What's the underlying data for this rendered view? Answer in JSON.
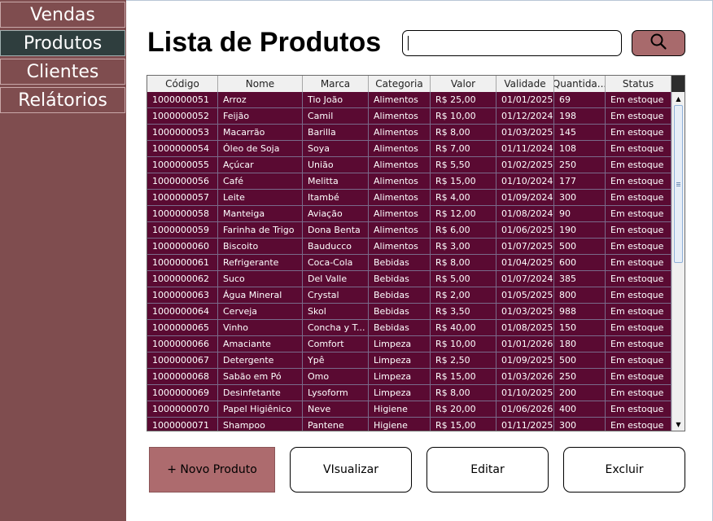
{
  "sidebar": {
    "items": [
      {
        "label": "Vendas"
      },
      {
        "label": "Produtos"
      },
      {
        "label": "Clientes"
      },
      {
        "label": "Relátorios"
      }
    ],
    "active": "Produtos"
  },
  "header": {
    "title": "Lista de Produtos"
  },
  "search": {
    "value": "",
    "placeholder": "",
    "button_icon": "search-icon"
  },
  "table": {
    "columns": [
      "Código",
      "Nome",
      "Marca",
      "Categoria",
      "Valor",
      "Validade",
      "Quantida...",
      "Status"
    ],
    "rows": [
      [
        "1000000051",
        "Arroz",
        "Tio João",
        "Alimentos",
        "R$ 25,00",
        "01/01/2025",
        "69",
        "Em estoque"
      ],
      [
        "1000000052",
        "Feijão",
        "Camil",
        "Alimentos",
        "R$ 10,00",
        "01/12/2024",
        "198",
        "Em estoque"
      ],
      [
        "1000000053",
        "Macarrão",
        "Barilla",
        "Alimentos",
        "R$ 8,00",
        "01/03/2025",
        "145",
        "Em estoque"
      ],
      [
        "1000000054",
        "Óleo de Soja",
        "Soya",
        "Alimentos",
        "R$ 7,00",
        "01/11/2024",
        "108",
        "Em estoque"
      ],
      [
        "1000000055",
        "Açúcar",
        "União",
        "Alimentos",
        "R$ 5,50",
        "01/02/2025",
        "250",
        "Em estoque"
      ],
      [
        "1000000056",
        "Café",
        "Melitta",
        "Alimentos",
        "R$ 15,00",
        "01/10/2024",
        "177",
        "Em estoque"
      ],
      [
        "1000000057",
        "Leite",
        "Itambé",
        "Alimentos",
        "R$ 4,00",
        "01/09/2024",
        "300",
        "Em estoque"
      ],
      [
        "1000000058",
        "Manteiga",
        "Aviação",
        "Alimentos",
        "R$ 12,00",
        "01/08/2024",
        "90",
        "Em estoque"
      ],
      [
        "1000000059",
        "Farinha de Trigo",
        "Dona Benta",
        "Alimentos",
        "R$ 6,00",
        "01/06/2025",
        "190",
        "Em estoque"
      ],
      [
        "1000000060",
        "Biscoito",
        "Bauducco",
        "Alimentos",
        "R$ 3,00",
        "01/07/2025",
        "500",
        "Em estoque"
      ],
      [
        "1000000061",
        "Refrigerante",
        "Coca-Cola",
        "Bebidas",
        "R$ 8,00",
        "01/04/2025",
        "600",
        "Em estoque"
      ],
      [
        "1000000062",
        "Suco",
        "Del Valle",
        "Bebidas",
        "R$ 5,00",
        "01/07/2024",
        "385",
        "Em estoque"
      ],
      [
        "1000000063",
        "Água Mineral",
        "Crystal",
        "Bebidas",
        "R$ 2,00",
        "01/05/2025",
        "800",
        "Em estoque"
      ],
      [
        "1000000064",
        "Cerveja",
        "Skol",
        "Bebidas",
        "R$ 3,50",
        "01/03/2025",
        "988",
        "Em estoque"
      ],
      [
        "1000000065",
        "Vinho",
        "Concha y T...",
        "Bebidas",
        "R$ 40,00",
        "01/08/2025",
        "150",
        "Em estoque"
      ],
      [
        "1000000066",
        "Amaciante",
        "Comfort",
        "Limpeza",
        "R$ 10,00",
        "01/01/2026",
        "180",
        "Em estoque"
      ],
      [
        "1000000067",
        "Detergente",
        "Ypê",
        "Limpeza",
        "R$ 2,50",
        "01/09/2025",
        "500",
        "Em estoque"
      ],
      [
        "1000000068",
        "Sabão em Pó",
        "Omo",
        "Limpeza",
        "R$ 15,00",
        "01/03/2026",
        "250",
        "Em estoque"
      ],
      [
        "1000000069",
        "Desinfetante",
        "Lysoform",
        "Limpeza",
        "R$ 8,00",
        "01/10/2025",
        "200",
        "Em estoque"
      ],
      [
        "1000000070",
        "Papel Higiênico",
        "Neve",
        "Higiene",
        "R$ 20,00",
        "01/06/2026",
        "400",
        "Em estoque"
      ],
      [
        "1000000071",
        "Shampoo",
        "Pantene",
        "Higiene",
        "R$ 15,00",
        "01/11/2025",
        "300",
        "Em estoque"
      ]
    ]
  },
  "actions": {
    "new_label": "+ Novo Produto",
    "view_label": "VIsualizar",
    "edit_label": "Editar",
    "delete_label": "Excluir"
  },
  "colors": {
    "sidebar": "#7f4d4f",
    "sidebar_active": "#2f3e3e",
    "row_bg": "#5a0a32",
    "accent_button": "#ad6b6e"
  }
}
